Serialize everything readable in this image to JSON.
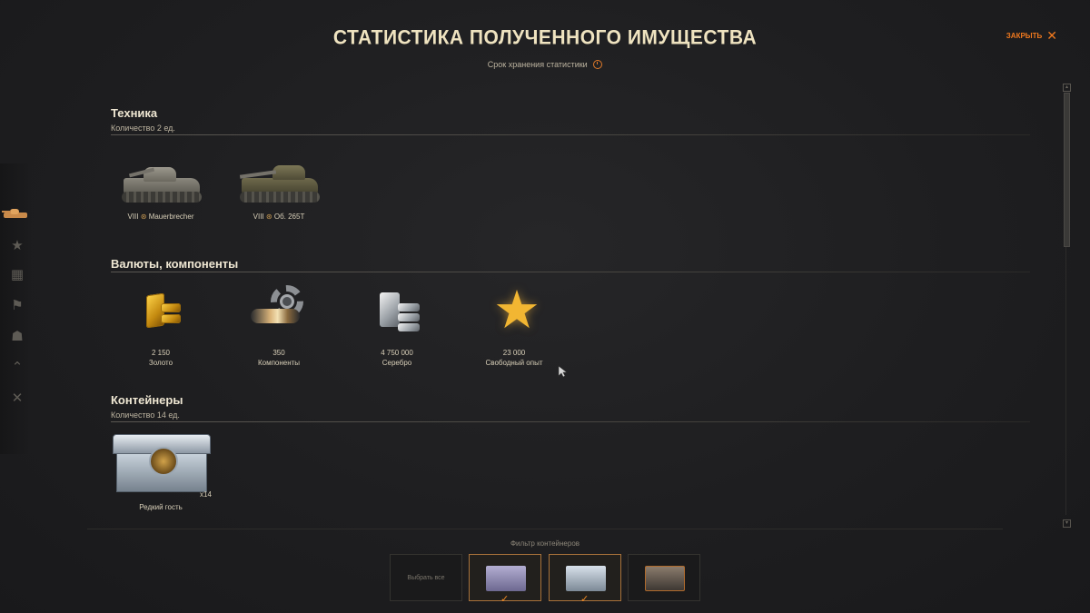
{
  "header": {
    "title": "СТАТИСТИКА ПОЛУЧЕННОГО ИМУЩЕСТВА",
    "subtitle": "Срок хранения статистики",
    "close_label": "ЗАКРЫТЬ",
    "close_icon": "close-icon"
  },
  "sidebar": {
    "items": [
      {
        "icon": "tank-icon",
        "active": true
      },
      {
        "icon": "stars-icon"
      },
      {
        "icon": "garage-icon"
      },
      {
        "icon": "flag-icon"
      },
      {
        "icon": "players-icon"
      },
      {
        "icon": "rank-chevron-icon"
      },
      {
        "icon": "tools-icon"
      }
    ]
  },
  "sections": {
    "vehicles": {
      "title": "Техника",
      "subtitle": "Количество 2 ед.",
      "items": [
        {
          "tier": "VIII",
          "name": "Mauerbrecher"
        },
        {
          "tier": "VIII",
          "name": "Об. 265Т"
        }
      ]
    },
    "currencies": {
      "title": "Валюты, компоненты",
      "items": [
        {
          "value": "2 150",
          "label": "Золото",
          "icon": "gold-bars-icon"
        },
        {
          "value": "350",
          "label": "Компоненты",
          "icon": "gear-components-icon"
        },
        {
          "value": "4 750 000",
          "label": "Серебро",
          "icon": "silver-bars-icon"
        },
        {
          "value": "23 000",
          "label": "Свободный опыт",
          "icon": "star-icon"
        }
      ]
    },
    "containers": {
      "title": "Контейнеры",
      "subtitle": "Количество 14 ед.",
      "items": [
        {
          "label": "Редкий гость",
          "count": "x14"
        }
      ]
    }
  },
  "filter": {
    "label": "Фильтр контейнеров",
    "select_all": "Выбрать все",
    "chips": [
      {
        "selected": true,
        "color": "#8f8ab0"
      },
      {
        "selected": true,
        "color": "#a9b8c6"
      },
      {
        "selected": false,
        "color": "#7c4b2a"
      }
    ]
  }
}
